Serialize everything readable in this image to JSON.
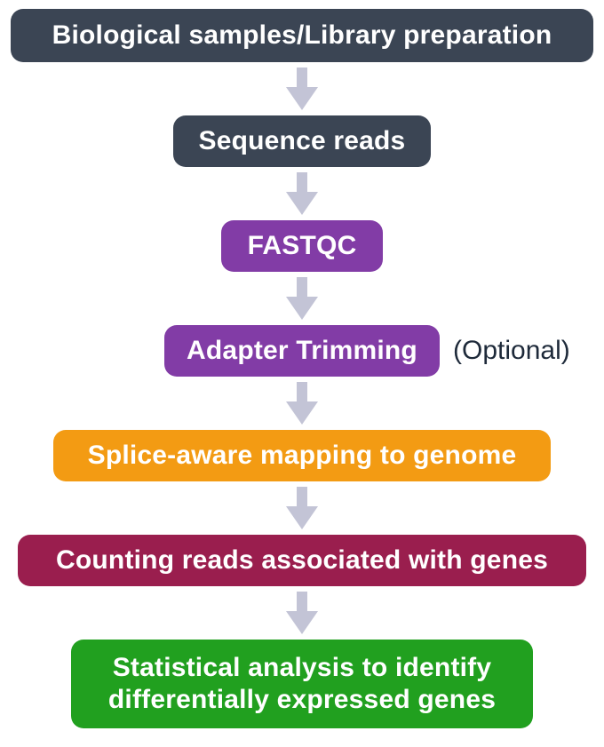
{
  "colors": {
    "dark": "#3b4554",
    "purple": "#823ca6",
    "orange": "#f39b13",
    "maroon": "#9a1e4e",
    "green": "#21a01f",
    "arrow": "#c3c4d6",
    "text_annot": "#1e2a3a"
  },
  "nodes": {
    "n1": {
      "label": "Biological samples/Library preparation"
    },
    "n2": {
      "label": "Sequence reads"
    },
    "n3": {
      "label": "FASTQC"
    },
    "n4": {
      "label": "Adapter Trimming"
    },
    "n5": {
      "label": "Splice-aware mapping to genome"
    },
    "n6": {
      "label": "Counting reads associated with genes"
    },
    "n7": {
      "label": "Statistical analysis to identify differentially expressed genes"
    }
  },
  "annotations": {
    "optional": "(Optional)"
  }
}
